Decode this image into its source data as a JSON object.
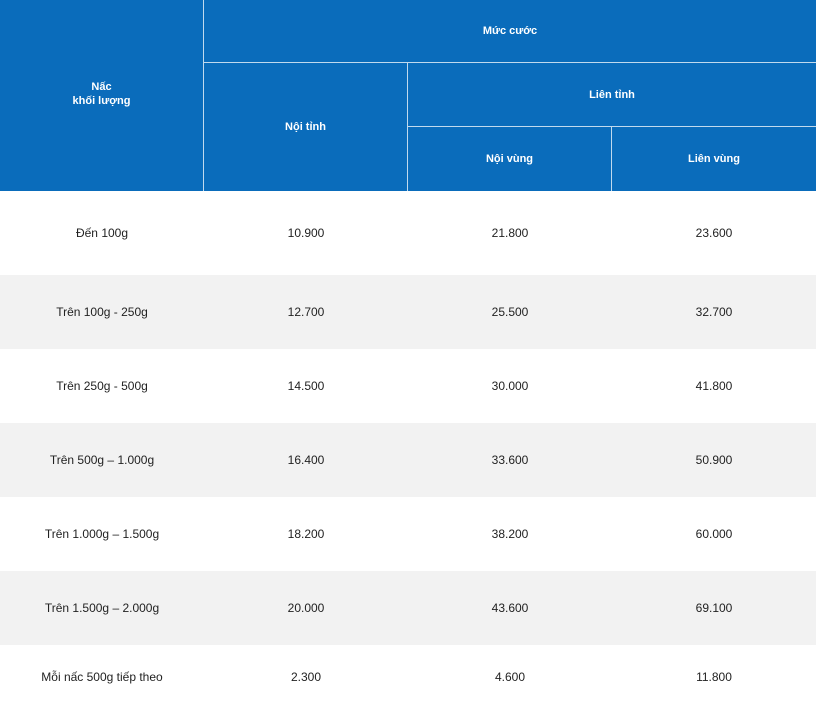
{
  "header": {
    "weight_line1": "Nấc",
    "weight_line2": "khối lượng",
    "rate": "Mức cước",
    "intra_province": "Nội tỉnh",
    "inter_province": "Liên tỉnh",
    "intra_region": "Nội vùng",
    "inter_region": "Liên vùng"
  },
  "rows": [
    {
      "weight": "Đến  100g",
      "intra_province": "10.900",
      "intra_region": "21.800",
      "inter_region": "23.600"
    },
    {
      "weight": "Trên  100g - 250g",
      "intra_province": "12.700",
      "intra_region": "25.500",
      "inter_region": "32.700"
    },
    {
      "weight": "Trên 250g - 500g",
      "intra_province": "14.500",
      "intra_region": "30.000",
      "inter_region": "41.800"
    },
    {
      "weight": "Trên  500g – 1.000g",
      "intra_province": "16.400",
      "intra_region": "33.600",
      "inter_region": "50.900"
    },
    {
      "weight": "Trên  1.000g – 1.500g",
      "intra_province": "18.200",
      "intra_region": "38.200",
      "inter_region": "60.000"
    },
    {
      "weight": "Trên  1.500g – 2.000g",
      "intra_province": "20.000",
      "intra_region": "43.600",
      "inter_region": "69.100"
    },
    {
      "weight": "Mỗi  nấc 500g tiếp theo",
      "intra_province": "2.300",
      "intra_region": "4.600",
      "inter_region": "11.800"
    }
  ],
  "colors": {
    "header_bg": "#0a6cbb",
    "alt_row_bg": "#f2f2f2"
  }
}
